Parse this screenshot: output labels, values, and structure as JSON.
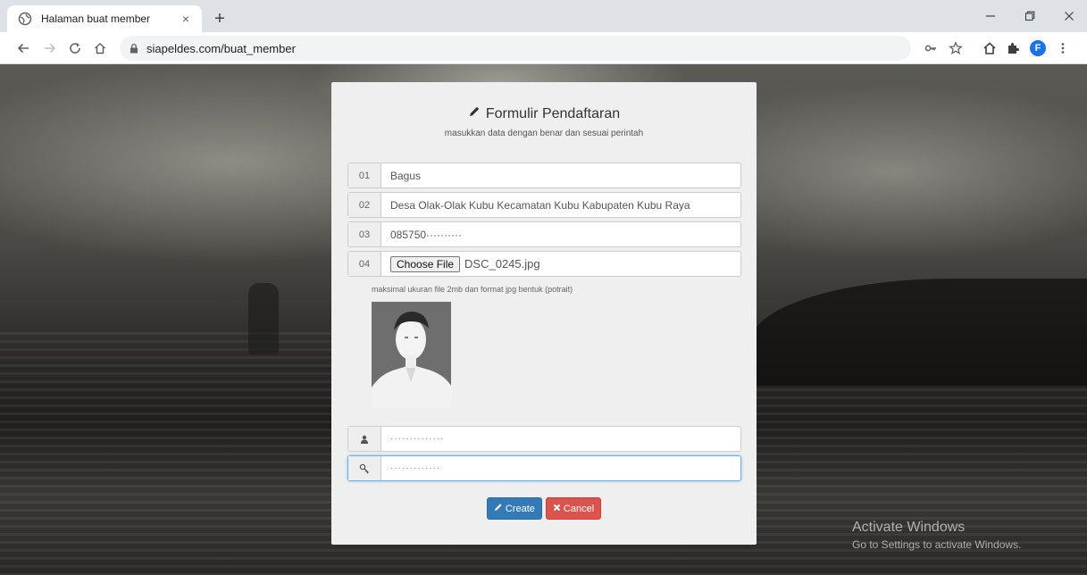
{
  "browser": {
    "tab_title": "Halaman buat member",
    "tab_close": "×",
    "new_tab": "+",
    "url": "siapeldes.com/buat_member",
    "profile_initial": "F"
  },
  "form": {
    "title": "Formulir Pendaftaran",
    "subtitle": "masukkan data dengan benar dan sesuai perintah",
    "rows": [
      {
        "num": "01",
        "value": "Bagus"
      },
      {
        "num": "02",
        "value": "Desa Olak-Olak Kubu Kecamatan Kubu Kabupaten Kubu Raya"
      },
      {
        "num": "03",
        "value": "085750··········"
      },
      {
        "num": "04",
        "file_button": "Choose File",
        "value": "DSC_0245.jpg"
      }
    ],
    "hint": "maksimal ukuran file 2mb dan format jpg bentuk (potrait)",
    "username_value": "··············",
    "password_value": "·············",
    "create_label": "Create",
    "cancel_label": "Cancel"
  },
  "watermark": {
    "line1": "Activate Windows",
    "line2": "Go to Settings to activate Windows."
  },
  "colors": {
    "create": "#337ab7",
    "cancel": "#d9534f",
    "focus": "#66afe9",
    "profile": "#1a73e8"
  }
}
